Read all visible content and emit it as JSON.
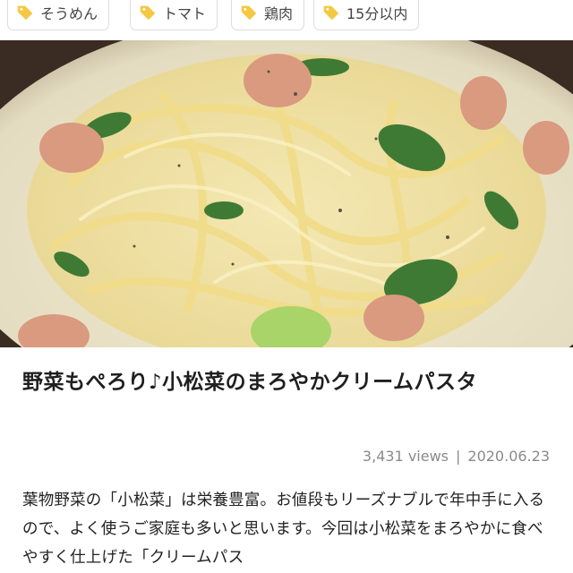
{
  "tags": [
    {
      "label": "そうめん"
    },
    {
      "label": "トマト"
    },
    {
      "label": "鶏肉"
    },
    {
      "label": "15分以内"
    }
  ],
  "tag_icon": "price-tag-icon",
  "tag_icon_color": "#f5c842",
  "article": {
    "title": "野菜もぺろり♪小松菜のまろやかクリームパスタ",
    "views": "3,431 views",
    "separator": "|",
    "date": "2020.06.23",
    "description": "葉物野菜の「小松菜」は栄養豊富。お値段もリーズナブルで年中手に入るので、よく使うご家庭も多いと思います。今回は小松菜をまろやかに食べやすく仕上げた「クリームパス"
  }
}
